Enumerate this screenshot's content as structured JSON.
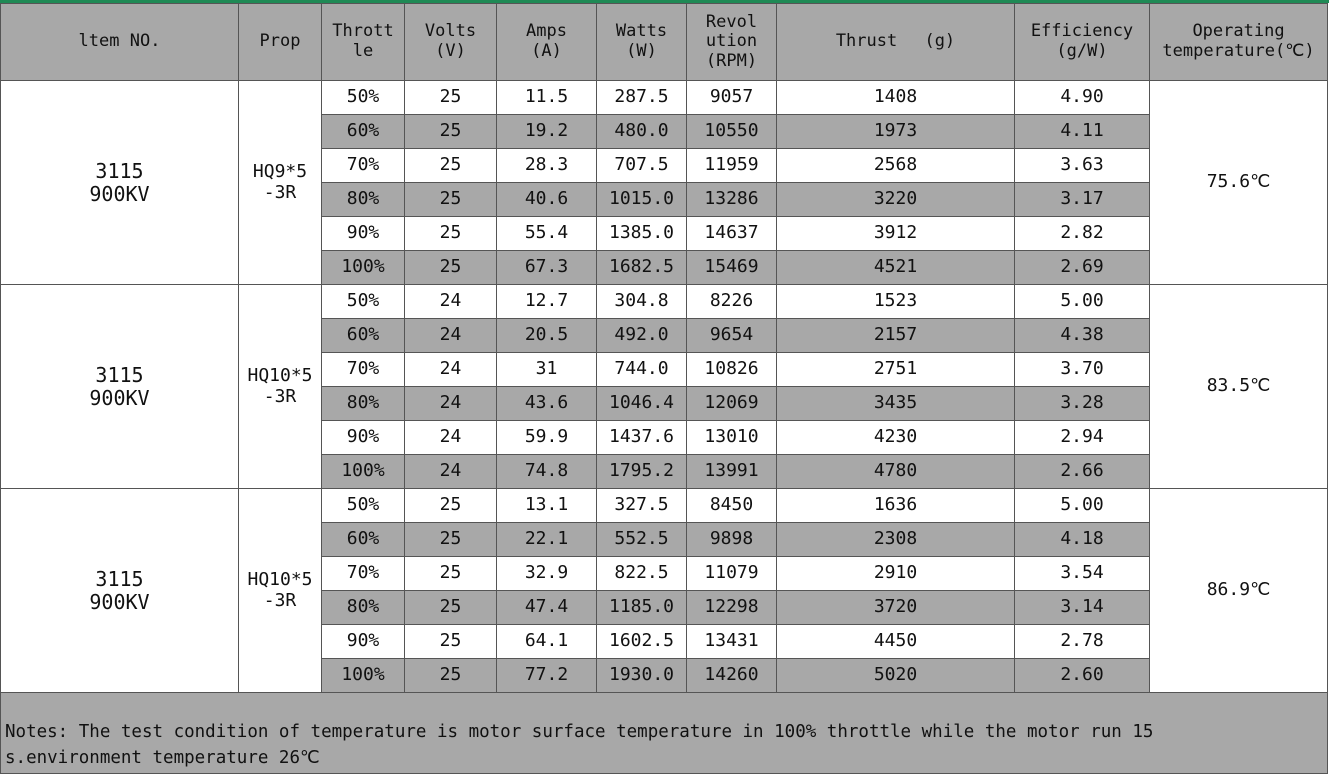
{
  "headers": [
    {
      "key": "item",
      "lines": [
        "ltem NO."
      ]
    },
    {
      "key": "prop",
      "lines": [
        "Prop"
      ]
    },
    {
      "key": "throttle",
      "lines": [
        "Thrott",
        "le"
      ]
    },
    {
      "key": "volts",
      "lines": [
        "Volts",
        "(V)"
      ]
    },
    {
      "key": "amps",
      "lines": [
        "Amps",
        "(A)"
      ]
    },
    {
      "key": "watts",
      "lines": [
        "Watts",
        "(W)"
      ]
    },
    {
      "key": "rev",
      "lines": [
        "Revol",
        "ution",
        "(RPM)"
      ]
    },
    {
      "key": "thrust",
      "lines": [
        "Thrust　 (g)"
      ]
    },
    {
      "key": "eff",
      "lines": [
        "Efficiency",
        "(g/W)"
      ]
    },
    {
      "key": "temp",
      "lines": [
        "Operating",
        "temperature(℃)"
      ]
    }
  ],
  "groups": [
    {
      "model_lines": [
        "3115",
        "900KV"
      ],
      "prop_lines": [
        "HQ9*5",
        "-3R"
      ],
      "temperature": "75.6℃",
      "rows": [
        [
          "50%",
          "25",
          "11.5",
          "287.5",
          "9057",
          "1408",
          "4.90"
        ],
        [
          "60%",
          "25",
          "19.2",
          "480.0",
          "10550",
          "1973",
          "4.11"
        ],
        [
          "70%",
          "25",
          "28.3",
          "707.5",
          "11959",
          "2568",
          "3.63"
        ],
        [
          "80%",
          "25",
          "40.6",
          "1015.0",
          "13286",
          "3220",
          "3.17"
        ],
        [
          "90%",
          "25",
          "55.4",
          "1385.0",
          "14637",
          "3912",
          "2.82"
        ],
        [
          "100%",
          "25",
          "67.3",
          "1682.5",
          "15469",
          "4521",
          "2.69"
        ]
      ]
    },
    {
      "model_lines": [
        "3115",
        "900KV"
      ],
      "prop_lines": [
        "HQ10*5",
        "-3R"
      ],
      "temperature": "83.5℃",
      "rows": [
        [
          "50%",
          "24",
          "12.7",
          "304.8",
          "8226",
          "1523",
          "5.00"
        ],
        [
          "60%",
          "24",
          "20.5",
          "492.0",
          "9654",
          "2157",
          "4.38"
        ],
        [
          "70%",
          "24",
          "31",
          "744.0",
          "10826",
          "2751",
          "3.70"
        ],
        [
          "80%",
          "24",
          "43.6",
          "1046.4",
          "12069",
          "3435",
          "3.28"
        ],
        [
          "90%",
          "24",
          "59.9",
          "1437.6",
          "13010",
          "4230",
          "2.94"
        ],
        [
          "100%",
          "24",
          "74.8",
          "1795.2",
          "13991",
          "4780",
          "2.66"
        ]
      ]
    },
    {
      "model_lines": [
        "3115",
        "900KV"
      ],
      "prop_lines": [
        "HQ10*5",
        "-3R"
      ],
      "temperature": "86.9℃",
      "rows": [
        [
          "50%",
          "25",
          "13.1",
          "327.5",
          "8450",
          "1636",
          "5.00"
        ],
        [
          "60%",
          "25",
          "22.1",
          "552.5",
          "9898",
          "2308",
          "4.18"
        ],
        [
          "70%",
          "25",
          "32.9",
          "822.5",
          "11079",
          "2910",
          "3.54"
        ],
        [
          "80%",
          "25",
          "47.4",
          "1185.0",
          "12298",
          "3720",
          "3.14"
        ],
        [
          "90%",
          "25",
          "64.1",
          "1602.5",
          "13431",
          "4450",
          "2.78"
        ],
        [
          "100%",
          "25",
          "77.2",
          "1930.0",
          "14260",
          "5020",
          "2.60"
        ]
      ]
    }
  ],
  "notes_lines": [
    "Notes: The test condition of temperature is motor surface temperature in 100% throttle while the motor run 15",
    "s.environment temperature 26℃"
  ],
  "colors": {
    "header_bg": "#a8a8a8",
    "shaded_row": "#a8a8a8",
    "accent_line": "#1f8a55",
    "border": "#555555"
  }
}
